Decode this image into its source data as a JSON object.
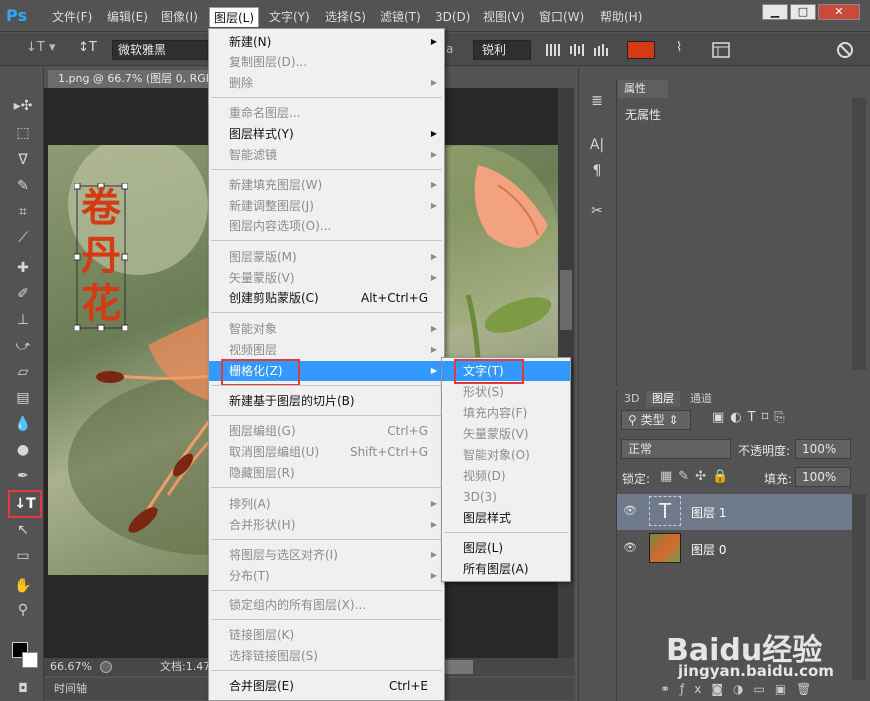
{
  "app": {
    "logo": "Ps",
    "accent": "#31a8ff"
  },
  "menubar": {
    "items": [
      "文件(F)",
      "编辑(E)",
      "图像(I)",
      "图层(L)",
      "文字(Y)",
      "选择(S)",
      "滤镜(T)",
      "3D(D)",
      "视图(V)",
      "窗口(W)",
      "帮助(H)"
    ],
    "active": "图层(L)",
    "window_buttons": [
      "▁",
      "□",
      "✕"
    ]
  },
  "options": {
    "tool_icon": "text-tool-icon",
    "font_family": "微软雅黑",
    "antialias_prefix": "a",
    "antialias_value": "锐利",
    "text_color": "#d43a17"
  },
  "document": {
    "tab_title": "1.png @ 66.7% (图层 0, RGB",
    "canvas_text": [
      "卷",
      "丹",
      "花"
    ],
    "text_color": "#d33b12",
    "zoom": "66.67%",
    "status": "文档:1.47"
  },
  "timeline": {
    "label": "时间轴"
  },
  "layer_menu": {
    "items": [
      {
        "label": "新建(N)",
        "enabled": true,
        "submenu": true
      },
      {
        "label": "复制图层(D)...",
        "enabled": false
      },
      {
        "label": "删除",
        "enabled": false,
        "submenu": true
      },
      {
        "label": "重命名图层...",
        "enabled": false
      },
      {
        "label": "图层样式(Y)",
        "enabled": true,
        "submenu": true
      },
      {
        "label": "智能滤镜",
        "enabled": false,
        "submenu": true
      },
      {
        "label": "新建填充图层(W)",
        "enabled": false,
        "submenu": true
      },
      {
        "label": "新建调整图层(J)",
        "enabled": false,
        "submenu": true
      },
      {
        "label": "图层内容选项(O)...",
        "enabled": false
      },
      {
        "label": "图层蒙版(M)",
        "enabled": false,
        "submenu": true
      },
      {
        "label": "矢量蒙版(V)",
        "enabled": false,
        "submenu": true
      },
      {
        "label": "创建剪贴蒙版(C)",
        "enabled": true,
        "shortcut": "Alt+Ctrl+G"
      },
      {
        "label": "智能对象",
        "enabled": false,
        "submenu": true
      },
      {
        "label": "视频图层",
        "enabled": false,
        "submenu": true
      },
      {
        "label": "栅格化(Z)",
        "enabled": true,
        "submenu": true,
        "highlighted": true
      },
      {
        "label": "新建基于图层的切片(B)",
        "enabled": true
      },
      {
        "label": "图层编组(G)",
        "enabled": false,
        "shortcut": "Ctrl+G"
      },
      {
        "label": "取消图层编组(U)",
        "enabled": false,
        "shortcut": "Shift+Ctrl+G"
      },
      {
        "label": "隐藏图层(R)",
        "enabled": false
      },
      {
        "label": "排列(A)",
        "enabled": false,
        "submenu": true
      },
      {
        "label": "合并形状(H)",
        "enabled": false,
        "submenu": true
      },
      {
        "label": "将图层与选区对齐(I)",
        "enabled": false,
        "submenu": true
      },
      {
        "label": "分布(T)",
        "enabled": false,
        "submenu": true
      },
      {
        "label": "锁定组内的所有图层(X)...",
        "enabled": false
      },
      {
        "label": "链接图层(K)",
        "enabled": false
      },
      {
        "label": "选择链接图层(S)",
        "enabled": false
      },
      {
        "label": "合并图层(E)",
        "enabled": true,
        "shortcut": "Ctrl+E"
      }
    ]
  },
  "rasterize_submenu": {
    "items": [
      {
        "label": "文字(T)",
        "enabled": true,
        "highlighted": true
      },
      {
        "label": "形状(S)",
        "enabled": false
      },
      {
        "label": "填充内容(F)",
        "enabled": false
      },
      {
        "label": "矢量蒙版(V)",
        "enabled": false
      },
      {
        "label": "智能对象(O)",
        "enabled": false
      },
      {
        "label": "视频(D)",
        "enabled": false
      },
      {
        "label": "3D(3)",
        "enabled": false
      },
      {
        "label": "图层样式",
        "enabled": true
      },
      {
        "label": "图层(L)",
        "enabled": true
      },
      {
        "label": "所有图层(A)",
        "enabled": true
      }
    ]
  },
  "properties": {
    "tab": "属性",
    "content": "无属性"
  },
  "layers_panel": {
    "tabs": [
      "3D",
      "图层",
      "通道"
    ],
    "active_tab": "图层",
    "filter": "类型",
    "blend_mode": "正常",
    "opacity_label": "不透明度:",
    "opacity": "100%",
    "lock_label": "锁定:",
    "fill_label": "填充:",
    "fill": "100%",
    "layers": [
      {
        "name": "图层 1",
        "kind": "text",
        "selected": true,
        "thumb": "T"
      },
      {
        "name": "图层 0",
        "kind": "image",
        "selected": false
      }
    ]
  },
  "watermark": {
    "brand": "Baidu经验",
    "url": "jingyan.baidu.com"
  }
}
